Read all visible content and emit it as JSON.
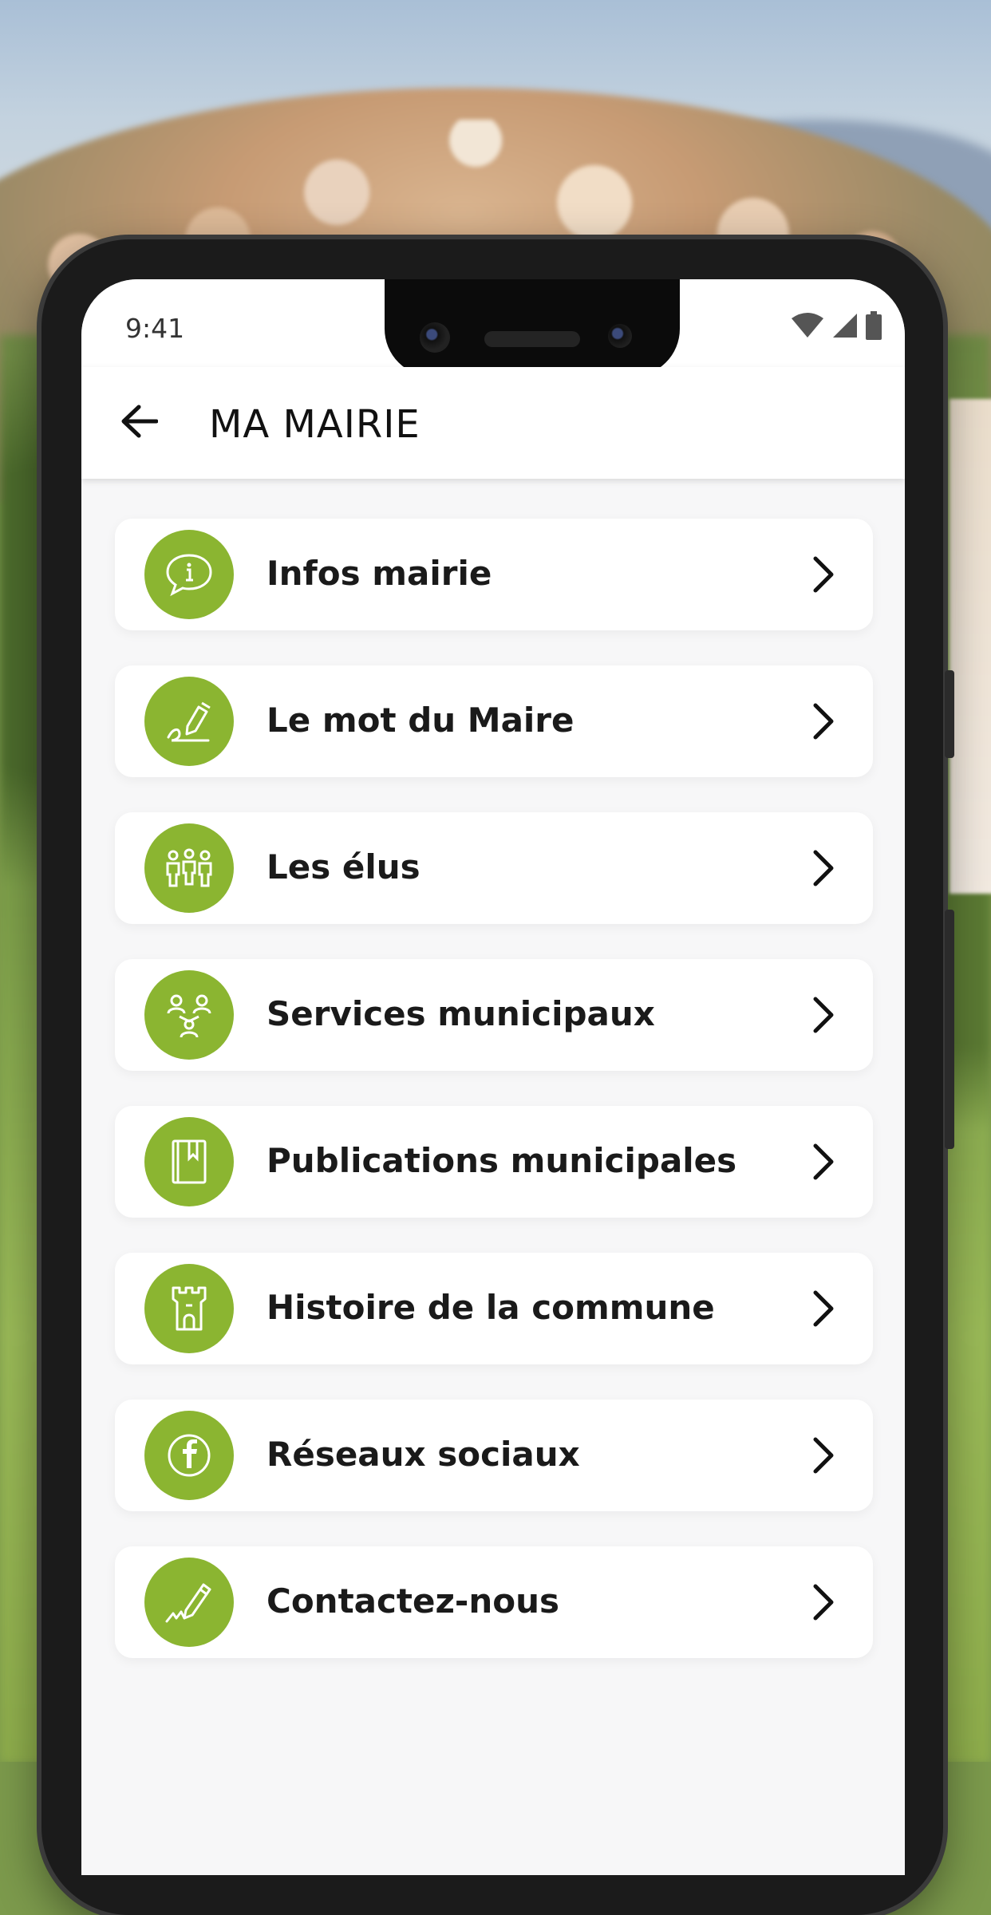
{
  "status_bar": {
    "time": "9:41",
    "icons": [
      "wifi-icon",
      "signal-icon",
      "battery-icon"
    ]
  },
  "header": {
    "back_icon": "arrow-left-icon",
    "title": "MA MAIRIE"
  },
  "menu": {
    "items": [
      {
        "label": "Infos mairie",
        "icon": "info-bubble-icon"
      },
      {
        "label": "Le mot du Maire",
        "icon": "pen-signature-icon"
      },
      {
        "label": "Les élus",
        "icon": "people-group-icon"
      },
      {
        "label": "Services municipaux",
        "icon": "staff-network-icon"
      },
      {
        "label": "Publications municipales",
        "icon": "book-bookmark-icon"
      },
      {
        "label": "Histoire de la commune",
        "icon": "castle-tower-icon"
      },
      {
        "label": "Réseaux sociaux",
        "icon": "facebook-icon"
      },
      {
        "label": "Contactez-nous",
        "icon": "pen-write-icon"
      }
    ],
    "chevron_icon": "chevron-right-icon"
  },
  "colors": {
    "accent": "#8bb531",
    "card_background": "#ffffff",
    "screen_background": "#f7f7f8",
    "text": "#1a1a1a"
  }
}
